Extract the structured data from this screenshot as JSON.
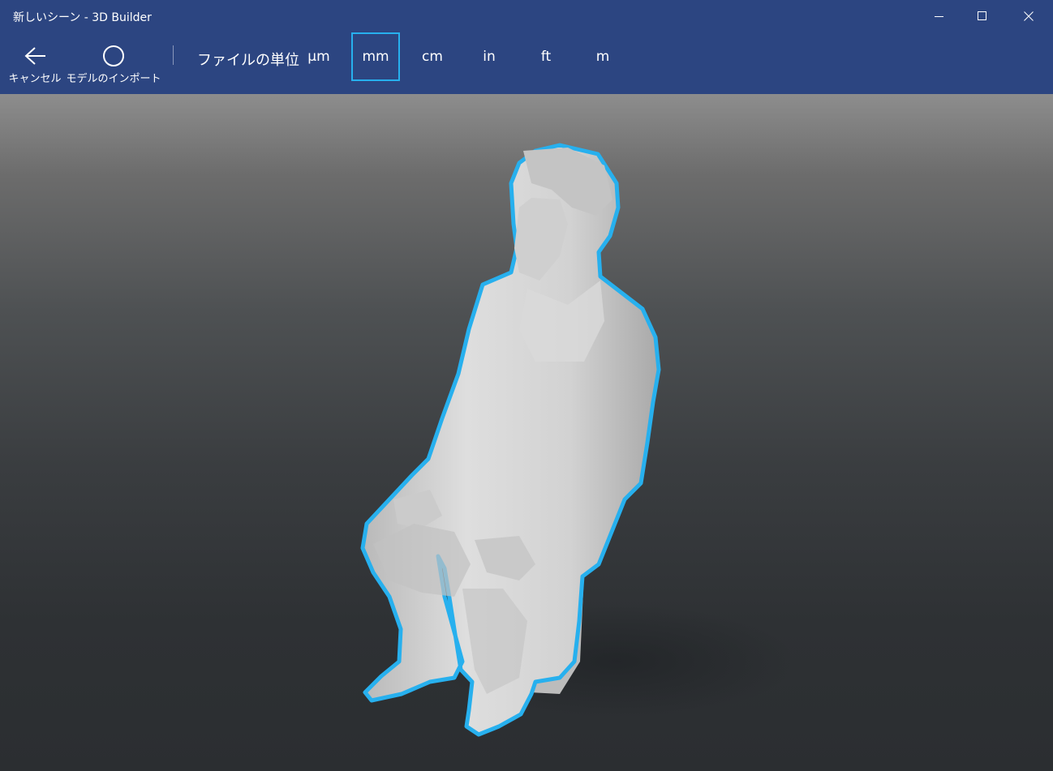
{
  "window": {
    "title": "新しいシーン - 3D Builder",
    "controls": {
      "minimize": "minimize-icon",
      "maximize": "maximize-icon",
      "close": "close-icon"
    }
  },
  "toolbar": {
    "cancel_label": "キャンセル",
    "import_label": "モデルのインポート",
    "units_label": "ファイルの単位",
    "units": [
      "μm",
      "mm",
      "cm",
      "in",
      "ft",
      "m"
    ],
    "selected_unit": "mm"
  },
  "colors": {
    "titlebar": "#2c4581",
    "accent": "#27b0ee",
    "model": "#d8d8d8"
  },
  "viewport": {
    "model_icon": "seated-person-model"
  }
}
